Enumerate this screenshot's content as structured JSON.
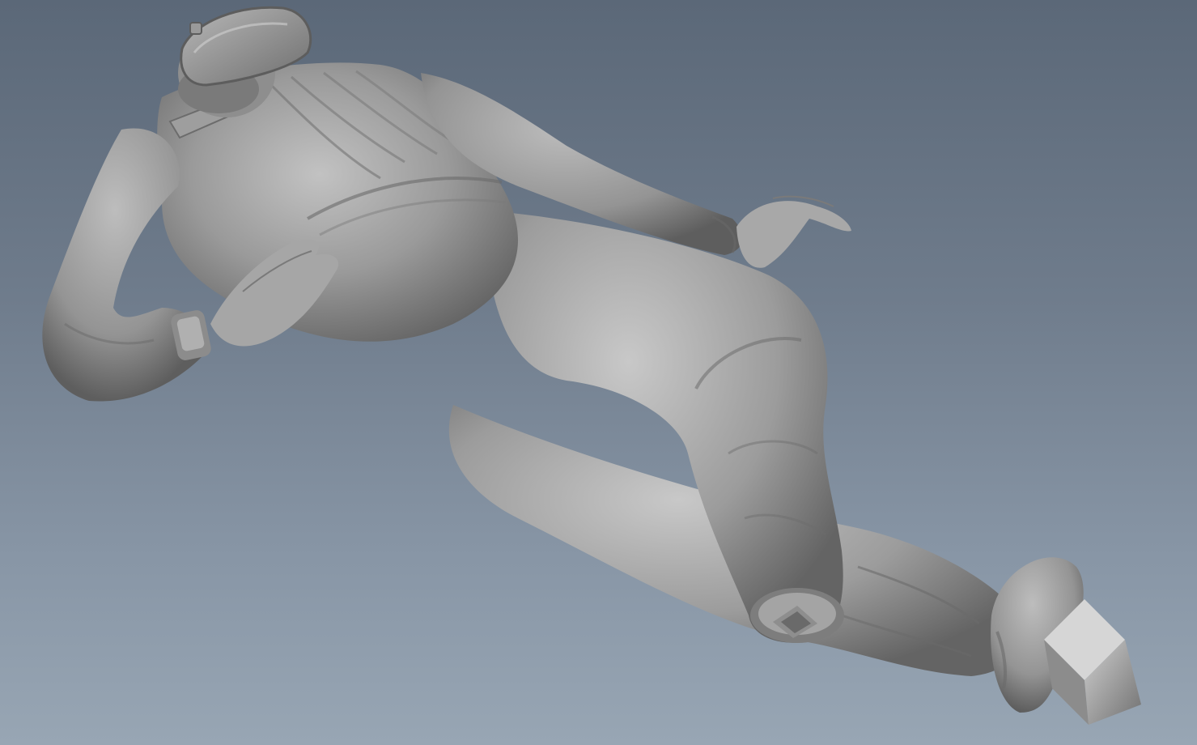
{
  "scene": {
    "description_label": "",
    "background": {
      "top_color": "#5b6878",
      "bottom_color": "#98a6b4"
    },
    "model_color": "#8a8a8a",
    "highlight_color": "#c4c4c4",
    "shadow_color": "#4e4e4e"
  }
}
